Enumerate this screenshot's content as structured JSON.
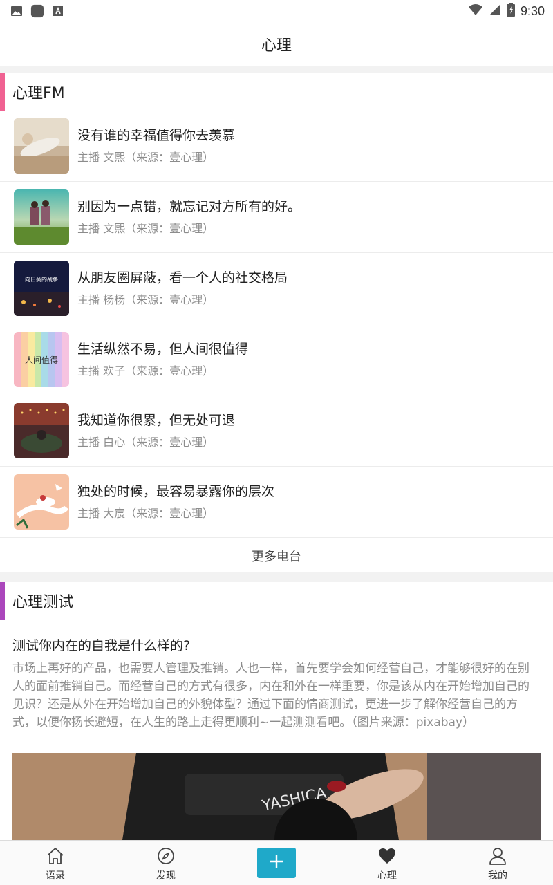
{
  "status_bar": {
    "time": "9:30"
  },
  "header": {
    "title": "心理"
  },
  "fm_section": {
    "title": "心理FM",
    "accent_color": "#f06292",
    "items": [
      {
        "title": "没有谁的幸福值得你去羡慕",
        "subtitle": "主播 文熙（来源：壹心理）"
      },
      {
        "title": "别因为一点错，就忘记对方所有的好。",
        "subtitle": "主播 文熙（来源：壹心理）"
      },
      {
        "title": "从朋友圈屏蔽，看一个人的社交格局",
        "subtitle": "主播 杨杨（来源：壹心理）"
      },
      {
        "title": "生活纵然不易，但人间很值得",
        "subtitle": "主播 欢子（来源：壹心理）"
      },
      {
        "title": "我知道你很累，但无处可退",
        "subtitle": "主播 白心（来源：壹心理）"
      },
      {
        "title": "独处的时候，最容易暴露你的层次",
        "subtitle": "主播 大宸（来源：壹心理）"
      }
    ],
    "more_label": "更多电台"
  },
  "test_section": {
    "title": "心理测试",
    "accent_color": "#ab47bc",
    "test_title": "测试你内在的自我是什么样的?",
    "test_desc": "市场上再好的产品，也需要人管理及推销。人也一样，首先要学会如何经营自己，才能够很好的在别人的面前推销自己。而经营自己的方式有很多，内在和外在一样重要，你是该从内在开始增加自己的见识？还是从外在开始增加自己的外貌体型？通过下面的情商测试，更进一步了解你经营自己的方式，以便你扬长避短，在人生的路上走得更顺利~一起测测看吧。（图片来源：pixabay）",
    "image_text": "YASHICA"
  },
  "thumb_texts": {
    "thumb3": "向日葵的战争",
    "thumb4": "人间值得"
  },
  "tabbar": {
    "tabs": [
      {
        "label": "语录",
        "icon": "home-icon"
      },
      {
        "label": "发现",
        "icon": "compass-icon"
      },
      {
        "label": "",
        "icon": "add-icon"
      },
      {
        "label": "心理",
        "icon": "heart-icon"
      },
      {
        "label": "我的",
        "icon": "user-icon"
      }
    ],
    "accent_color": "#1fa9c9"
  }
}
